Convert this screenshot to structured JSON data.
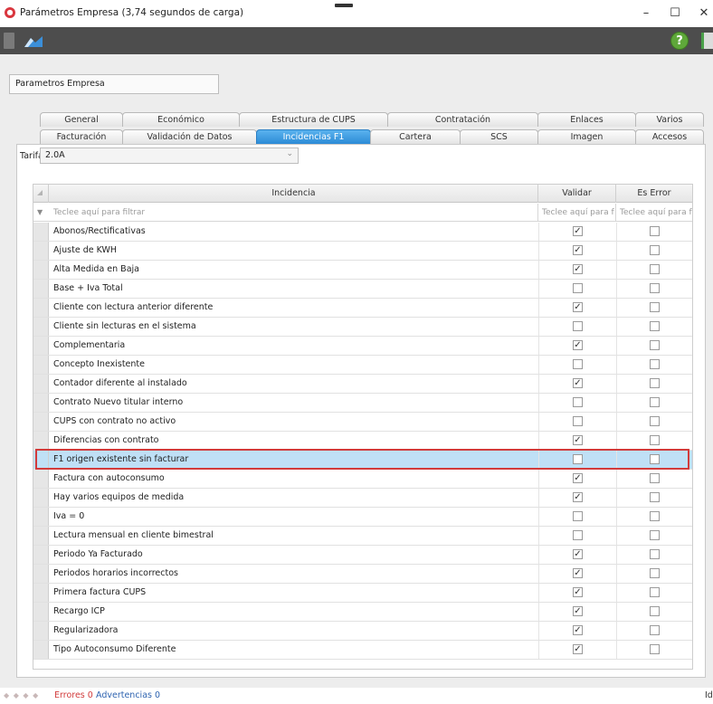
{
  "window": {
    "title": "Parámetros Empresa (3,74 segundos de carga)",
    "minimize": "–",
    "maximize": "☐",
    "close": "✕"
  },
  "toolbar": {
    "help": "?"
  },
  "section": {
    "label": "Parametros Empresa"
  },
  "tabs_row1": [
    "General",
    "Económico",
    "Estructura de CUPS",
    "Contratación",
    "Enlaces",
    "Varios"
  ],
  "tabs_row2": [
    "Facturación",
    "Validación de Datos",
    "Incidencias F1",
    "Cartera",
    "SCS",
    "Imagen",
    "Accesos"
  ],
  "active_tab": "Incidencias F1",
  "tarifa": {
    "label": "Tarifa",
    "value": "2.0A"
  },
  "grid": {
    "columns": [
      "Incidencia",
      "Validar",
      "Es Error"
    ],
    "filter_placeholders": [
      "Teclee aquí para filtrar",
      "Teclee aquí para f",
      "Teclee aquí para f"
    ],
    "rows": [
      {
        "name": "Abonos/Rectificativas",
        "validar": true,
        "es_error": false
      },
      {
        "name": "Ajuste de KWH",
        "validar": true,
        "es_error": false
      },
      {
        "name": "Alta Medida en Baja",
        "validar": true,
        "es_error": false
      },
      {
        "name": "Base + Iva Total",
        "validar": false,
        "es_error": false
      },
      {
        "name": "Cliente con lectura anterior diferente",
        "validar": true,
        "es_error": false
      },
      {
        "name": "Cliente sin lecturas en el sistema",
        "validar": false,
        "es_error": false
      },
      {
        "name": "Complementaria",
        "validar": true,
        "es_error": false
      },
      {
        "name": "Concepto Inexistente",
        "validar": false,
        "es_error": false
      },
      {
        "name": "Contador diferente al instalado",
        "validar": true,
        "es_error": false
      },
      {
        "name": "Contrato Nuevo titular interno",
        "validar": false,
        "es_error": false
      },
      {
        "name": "CUPS con contrato no activo",
        "validar": false,
        "es_error": false
      },
      {
        "name": "Diferencias con contrato",
        "validar": true,
        "es_error": false
      },
      {
        "name": "F1 origen existente sin facturar",
        "validar": false,
        "es_error": false,
        "selected": true
      },
      {
        "name": "Factura con autoconsumo",
        "validar": true,
        "es_error": false
      },
      {
        "name": "Hay varios equipos de medida",
        "validar": true,
        "es_error": false
      },
      {
        "name": "Iva = 0",
        "validar": false,
        "es_error": false
      },
      {
        "name": "Lectura mensual en cliente bimestral",
        "validar": false,
        "es_error": false
      },
      {
        "name": "Periodo Ya Facturado",
        "validar": true,
        "es_error": false
      },
      {
        "name": "Periodos horarios incorrectos",
        "validar": true,
        "es_error": false
      },
      {
        "name": "Primera factura CUPS",
        "validar": true,
        "es_error": false
      },
      {
        "name": "Recargo ICP",
        "validar": true,
        "es_error": false
      },
      {
        "name": "Regularizadora",
        "validar": true,
        "es_error": false
      },
      {
        "name": "Tipo Autoconsumo Diferente",
        "validar": true,
        "es_error": false
      }
    ]
  },
  "status": {
    "errors": "Errores 0",
    "warnings": "Advertencias 0",
    "right": "Id"
  },
  "colors": {
    "accent": "#2c8bd6",
    "selection": "#bfe0f6",
    "highlight_border": "#d23b3b",
    "toolbar": "#4d4d4d",
    "help": "#5fa83a"
  },
  "icons": {
    "app": "app-logo-icon",
    "help": "help-icon",
    "filter": "filter-icon",
    "check": "checkmark-icon"
  }
}
